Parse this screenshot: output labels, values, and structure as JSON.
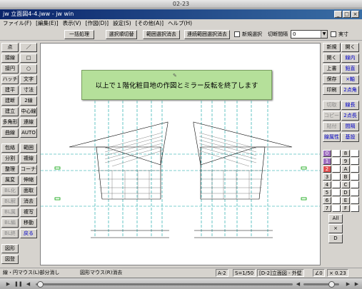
{
  "player": {
    "title": "02-23"
  },
  "window": {
    "title": "jw 立面図4-4.jww - jw win",
    "min": "_",
    "max": "□",
    "close": "×"
  },
  "menu": [
    "ファイル(F)",
    "[編集(E)]",
    "表示(V)",
    "[作図(D)]",
    "設定(S)",
    "[その他(A)]",
    "ヘルプ(H)"
  ],
  "toolbar": {
    "btn_all": "一括処理",
    "btn_sel_rel": "選択順切替",
    "btn_range_clear": "範囲選択消去",
    "btn_cont_clear": "連続範囲選択消去",
    "chk_newsel": "新規選択",
    "cut_label": "切断間隔",
    "cut_value": "0",
    "chk_real": "実寸"
  },
  "left_buttons": [
    [
      "点",
      "／"
    ],
    [
      "接線",
      "□"
    ],
    [
      "接円",
      "○"
    ],
    [
      "ハッチ",
      "文字"
    ],
    [
      "建平",
      "寸法"
    ],
    [
      "建断",
      "2線"
    ],
    [
      "建立",
      "中心線"
    ],
    [
      "多角形",
      "連線"
    ],
    [
      "曲線",
      "AUTO"
    ],
    [
      "包絡",
      "範囲"
    ],
    [
      "分割",
      "複線"
    ],
    [
      "整理",
      "コーナー"
    ],
    [
      "属変",
      "伸縮"
    ],
    [
      "BL化",
      "面取"
    ],
    [
      "BL解",
      "消去"
    ],
    [
      "BL属",
      "複写"
    ],
    [
      "BL編",
      "移動"
    ],
    [
      "BL終",
      "戻る"
    ],
    [
      "図形",
      ""
    ],
    [
      "図登",
      ""
    ]
  ],
  "right_buttons": [
    [
      "新規",
      "開く"
    ],
    [
      "開く",
      "線内"
    ],
    [
      "上書",
      "鉛直"
    ],
    [
      "保存",
      "×軸"
    ],
    [
      "印刷",
      "2点角"
    ],
    [
      "切取",
      "線長"
    ],
    [
      "コピー",
      "2点長"
    ],
    [
      "貼付",
      "間隔"
    ],
    [
      "線属性",
      "基設"
    ]
  ],
  "layers": [
    "0",
    "1",
    "2",
    "3",
    "4",
    "5",
    "6",
    "7",
    "8",
    "9",
    "A",
    "B",
    "C",
    "D",
    "E",
    "F"
  ],
  "layer_extra": [
    "All",
    "×",
    "D"
  ],
  "overlay_text": "以上で１階化粧目地の作図とミラー反転を終了します",
  "status": {
    "left_hint": "線・円マウス(L)部分消し",
    "right_hint": "図形マウス(R)消去",
    "paper": "A-2",
    "scale": "S=1/50",
    "layer": "[D-2]立面図 - 外壁",
    "angle": "∠0",
    "zoom": "× 0.23"
  },
  "colors": {
    "cyan": "#00a0a0",
    "overlay_bg": "#b5e09a",
    "overlay_border": "#7aa060",
    "layer_red": "#e05050",
    "layer_purple": "#a070c0"
  }
}
